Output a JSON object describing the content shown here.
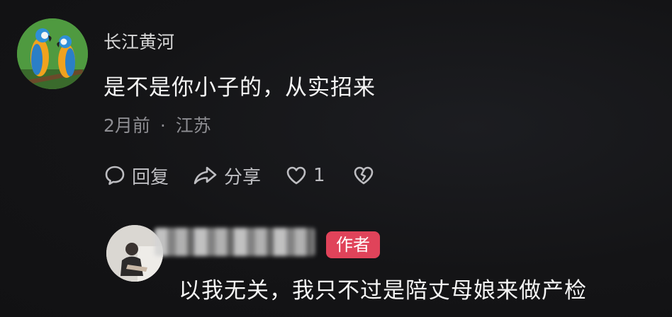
{
  "comment": {
    "username": "长江黄河",
    "text": "是不是你小子的，从实招来",
    "time": "2月前",
    "separator": "·",
    "location": "江苏",
    "actions": {
      "reply_label": "回复",
      "share_label": "分享",
      "like_count": "1"
    },
    "icons": {
      "avatar": "parrot-avatar",
      "reply": "speech-bubble-icon",
      "share": "share-arrow-icon",
      "like": "heart-icon",
      "dislike": "broken-heart-icon"
    }
  },
  "reply": {
    "author_badge": "作者",
    "text": "以我无关，我只不过是陪丈母娘来做产检",
    "icons": {
      "avatar": "person-photo-avatar"
    }
  },
  "colors": {
    "background": "#141416",
    "text_primary": "#f5f5f5",
    "text_meta": "#8d8d92",
    "badge": "#e0435a"
  }
}
